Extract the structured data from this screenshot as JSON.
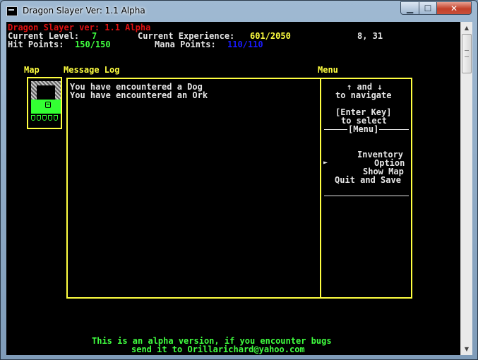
{
  "window": {
    "title": "Dragon Slayer  Ver: 1.1 Alpha"
  },
  "window_controls": {
    "minimize": "▁",
    "maximize": "☐",
    "close": "✕"
  },
  "scrollbar": {
    "up_arrow": "▲",
    "down_arrow": "▼"
  },
  "header": {
    "game_title": "Dragon Slayer ver: 1.1 Alpha",
    "level_label": "Current Level: ",
    "level_value": "7",
    "exp_label": "Current Experience: ",
    "exp_value": "601/2050",
    "coords": "8, 31",
    "hp_label": "Hit Points: ",
    "hp_value": "150/150",
    "mp_label": "Mana Points: ",
    "mp_value": "110/110"
  },
  "panels": {
    "map_label": "Map",
    "log_label": "Message Log",
    "menu_label": "Menu"
  },
  "message_log": [
    "You have encountered a Dog",
    "You have encountered an Ork"
  ],
  "menu": {
    "nav_hint_1": "↑ and ↓",
    "nav_hint_2": "to navigate",
    "enter_hint_1": "[Enter Key]",
    "enter_hint_2": "to select",
    "section_title": "[Menu]",
    "selector": "►",
    "items": [
      "Inventory",
      "Option",
      "Show Map",
      "Quit and Save"
    ]
  },
  "footer": {
    "line1": "This is an alpha version, if you encounter bugs",
    "line2": "send it to Orillarichard@yahoo.com"
  },
  "colors": {
    "title": "#e01010",
    "labels": "#e6e6e6",
    "borders": "#ffff40",
    "good": "#40ff40",
    "mana": "#1a1aff",
    "background": "#000000"
  },
  "icons": [
    "app-icon",
    "minimize-icon",
    "maximize-icon",
    "close-icon",
    "selector-arrow-icon",
    "scroll-up-icon",
    "scroll-down-icon"
  ]
}
